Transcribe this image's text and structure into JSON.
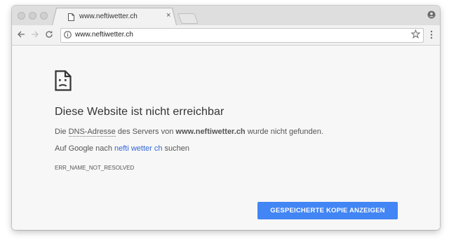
{
  "tab": {
    "title": "www.neftiwetter.ch",
    "close_glyph": "×"
  },
  "toolbar": {
    "url": "www.neftiwetter.ch"
  },
  "error_page": {
    "heading": "Diese Website ist nicht erreichbar",
    "line1_prefix": "Die ",
    "line1_dns": "DNS-Adresse",
    "line1_mid": " des Servers von ",
    "line1_host": "www.neftiwetter.ch",
    "line1_suffix": " wurde nicht gefunden.",
    "line2_prefix": "Auf Google nach ",
    "line2_link": "nefti wetter ch",
    "line2_suffix": " suchen",
    "error_code": "ERR_NAME_NOT_RESOLVED",
    "button_label": "GESPEICHERTE KOPIE ANZEIGEN"
  },
  "colors": {
    "accent_button": "#4285f4",
    "link": "#3367d6",
    "page_background": "#f7f7f7"
  },
  "icons": [
    "close-icon",
    "page-icon",
    "profile-icon",
    "back-arrow-icon",
    "forward-arrow-icon",
    "reload-icon",
    "info-icon",
    "star-icon",
    "menu-icon",
    "sad-document-icon"
  ]
}
